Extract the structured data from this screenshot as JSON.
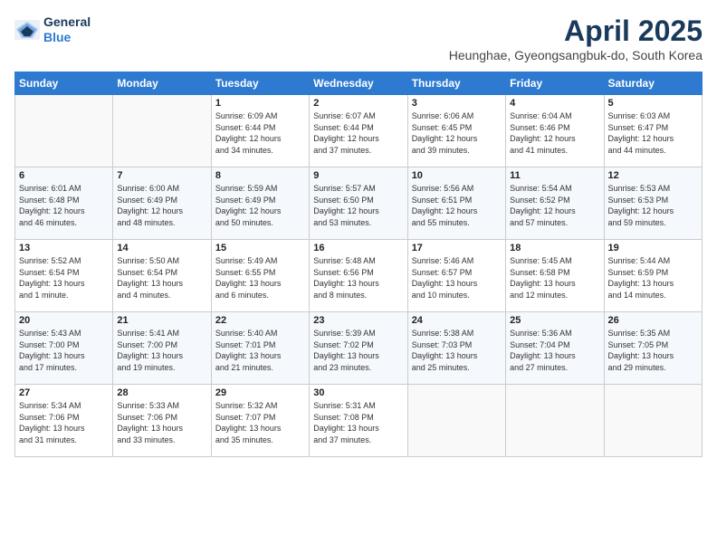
{
  "header": {
    "logo_line1": "General",
    "logo_line2": "Blue",
    "month": "April 2025",
    "location": "Heunghae, Gyeongsangbuk-do, South Korea"
  },
  "days_of_week": [
    "Sunday",
    "Monday",
    "Tuesday",
    "Wednesday",
    "Thursday",
    "Friday",
    "Saturday"
  ],
  "weeks": [
    [
      {
        "day": "",
        "info": ""
      },
      {
        "day": "",
        "info": ""
      },
      {
        "day": "1",
        "info": "Sunrise: 6:09 AM\nSunset: 6:44 PM\nDaylight: 12 hours\nand 34 minutes."
      },
      {
        "day": "2",
        "info": "Sunrise: 6:07 AM\nSunset: 6:44 PM\nDaylight: 12 hours\nand 37 minutes."
      },
      {
        "day": "3",
        "info": "Sunrise: 6:06 AM\nSunset: 6:45 PM\nDaylight: 12 hours\nand 39 minutes."
      },
      {
        "day": "4",
        "info": "Sunrise: 6:04 AM\nSunset: 6:46 PM\nDaylight: 12 hours\nand 41 minutes."
      },
      {
        "day": "5",
        "info": "Sunrise: 6:03 AM\nSunset: 6:47 PM\nDaylight: 12 hours\nand 44 minutes."
      }
    ],
    [
      {
        "day": "6",
        "info": "Sunrise: 6:01 AM\nSunset: 6:48 PM\nDaylight: 12 hours\nand 46 minutes."
      },
      {
        "day": "7",
        "info": "Sunrise: 6:00 AM\nSunset: 6:49 PM\nDaylight: 12 hours\nand 48 minutes."
      },
      {
        "day": "8",
        "info": "Sunrise: 5:59 AM\nSunset: 6:49 PM\nDaylight: 12 hours\nand 50 minutes."
      },
      {
        "day": "9",
        "info": "Sunrise: 5:57 AM\nSunset: 6:50 PM\nDaylight: 12 hours\nand 53 minutes."
      },
      {
        "day": "10",
        "info": "Sunrise: 5:56 AM\nSunset: 6:51 PM\nDaylight: 12 hours\nand 55 minutes."
      },
      {
        "day": "11",
        "info": "Sunrise: 5:54 AM\nSunset: 6:52 PM\nDaylight: 12 hours\nand 57 minutes."
      },
      {
        "day": "12",
        "info": "Sunrise: 5:53 AM\nSunset: 6:53 PM\nDaylight: 12 hours\nand 59 minutes."
      }
    ],
    [
      {
        "day": "13",
        "info": "Sunrise: 5:52 AM\nSunset: 6:54 PM\nDaylight: 13 hours\nand 1 minute."
      },
      {
        "day": "14",
        "info": "Sunrise: 5:50 AM\nSunset: 6:54 PM\nDaylight: 13 hours\nand 4 minutes."
      },
      {
        "day": "15",
        "info": "Sunrise: 5:49 AM\nSunset: 6:55 PM\nDaylight: 13 hours\nand 6 minutes."
      },
      {
        "day": "16",
        "info": "Sunrise: 5:48 AM\nSunset: 6:56 PM\nDaylight: 13 hours\nand 8 minutes."
      },
      {
        "day": "17",
        "info": "Sunrise: 5:46 AM\nSunset: 6:57 PM\nDaylight: 13 hours\nand 10 minutes."
      },
      {
        "day": "18",
        "info": "Sunrise: 5:45 AM\nSunset: 6:58 PM\nDaylight: 13 hours\nand 12 minutes."
      },
      {
        "day": "19",
        "info": "Sunrise: 5:44 AM\nSunset: 6:59 PM\nDaylight: 13 hours\nand 14 minutes."
      }
    ],
    [
      {
        "day": "20",
        "info": "Sunrise: 5:43 AM\nSunset: 7:00 PM\nDaylight: 13 hours\nand 17 minutes."
      },
      {
        "day": "21",
        "info": "Sunrise: 5:41 AM\nSunset: 7:00 PM\nDaylight: 13 hours\nand 19 minutes."
      },
      {
        "day": "22",
        "info": "Sunrise: 5:40 AM\nSunset: 7:01 PM\nDaylight: 13 hours\nand 21 minutes."
      },
      {
        "day": "23",
        "info": "Sunrise: 5:39 AM\nSunset: 7:02 PM\nDaylight: 13 hours\nand 23 minutes."
      },
      {
        "day": "24",
        "info": "Sunrise: 5:38 AM\nSunset: 7:03 PM\nDaylight: 13 hours\nand 25 minutes."
      },
      {
        "day": "25",
        "info": "Sunrise: 5:36 AM\nSunset: 7:04 PM\nDaylight: 13 hours\nand 27 minutes."
      },
      {
        "day": "26",
        "info": "Sunrise: 5:35 AM\nSunset: 7:05 PM\nDaylight: 13 hours\nand 29 minutes."
      }
    ],
    [
      {
        "day": "27",
        "info": "Sunrise: 5:34 AM\nSunset: 7:06 PM\nDaylight: 13 hours\nand 31 minutes."
      },
      {
        "day": "28",
        "info": "Sunrise: 5:33 AM\nSunset: 7:06 PM\nDaylight: 13 hours\nand 33 minutes."
      },
      {
        "day": "29",
        "info": "Sunrise: 5:32 AM\nSunset: 7:07 PM\nDaylight: 13 hours\nand 35 minutes."
      },
      {
        "day": "30",
        "info": "Sunrise: 5:31 AM\nSunset: 7:08 PM\nDaylight: 13 hours\nand 37 minutes."
      },
      {
        "day": "",
        "info": ""
      },
      {
        "day": "",
        "info": ""
      },
      {
        "day": "",
        "info": ""
      }
    ]
  ]
}
